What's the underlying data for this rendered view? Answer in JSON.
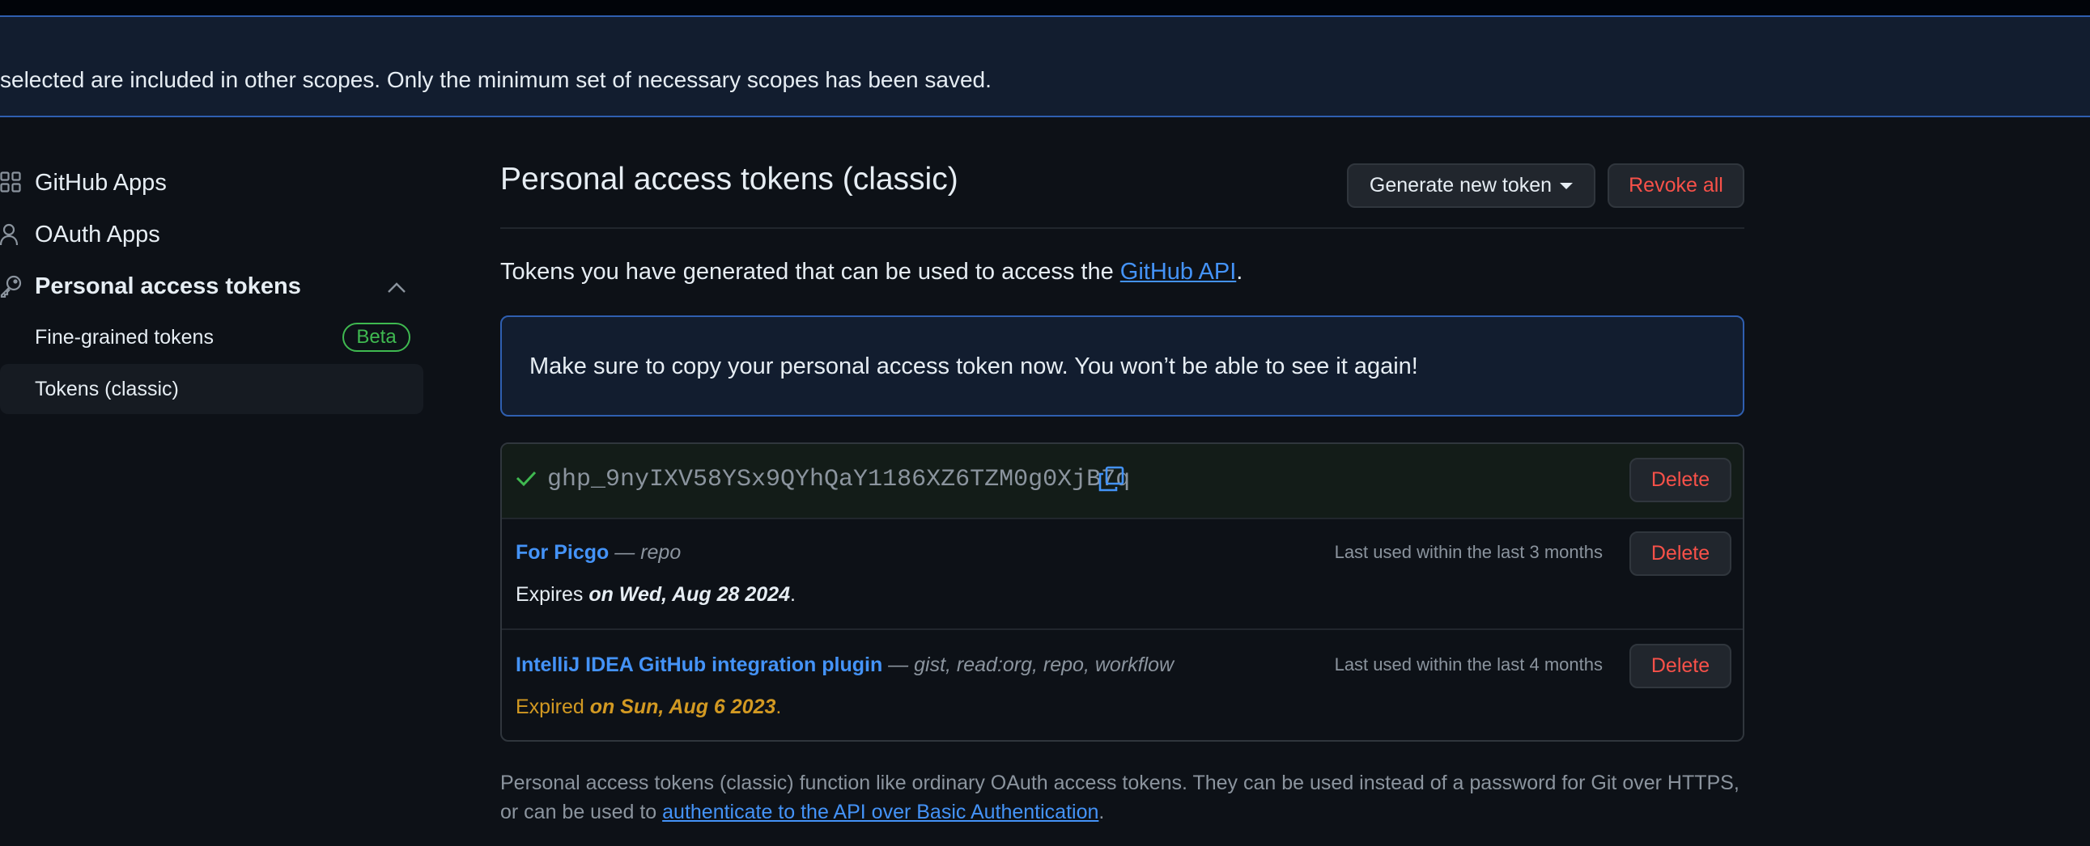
{
  "banner": {
    "text": "selected are included in other scopes. Only the minimum set of necessary scopes has been saved."
  },
  "sidebar": {
    "items": [
      {
        "label": "GitHub Apps",
        "icon": "apps-grid-icon"
      },
      {
        "label": "OAuth Apps",
        "icon": "person-icon"
      },
      {
        "label": "Personal access tokens",
        "icon": "key-icon"
      }
    ],
    "subitems": [
      {
        "label": "Fine-grained tokens",
        "badge": "Beta"
      },
      {
        "label": "Tokens (classic)"
      }
    ]
  },
  "main": {
    "title": "Personal access tokens (classic)",
    "generate_button": "Generate new token",
    "revoke_button": "Revoke all",
    "intro_prefix": "Tokens you have generated that can be used to access the ",
    "intro_link": "GitHub API",
    "intro_suffix": ".",
    "notice": "Make sure to copy your personal access token now. You won’t be able to see it again!",
    "new_token": {
      "value": "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",
      "delete_label": "Delete"
    },
    "tokens": [
      {
        "name": "For Picgo",
        "scopes": " — repo",
        "last_used": "Last used within the last 3 months",
        "expires_prefix": "Expires ",
        "expires_date": "on Wed, Aug 28 2024",
        "expires_suffix": ".",
        "delete_label": "Delete"
      },
      {
        "name": "IntelliJ IDEA GitHub integration plugin",
        "scopes": " — gist, read:org, repo, workflow",
        "last_used": "Last used within the last 4 months",
        "expires_prefix": "Expired ",
        "expires_date": "on Sun, Aug 6 2023",
        "expires_suffix": ".",
        "delete_label": "Delete"
      }
    ],
    "footer_prefix": "Personal access tokens (classic) function like ordinary OAuth access tokens. They can be used instead of a password for Git over HTTPS, or can be used to ",
    "footer_link": "authenticate to the API over Basic Authentication",
    "footer_suffix": "."
  },
  "colors": {
    "accent": "#4493f8",
    "danger": "#f85149",
    "success": "#3fb950",
    "warning": "#d29922"
  }
}
